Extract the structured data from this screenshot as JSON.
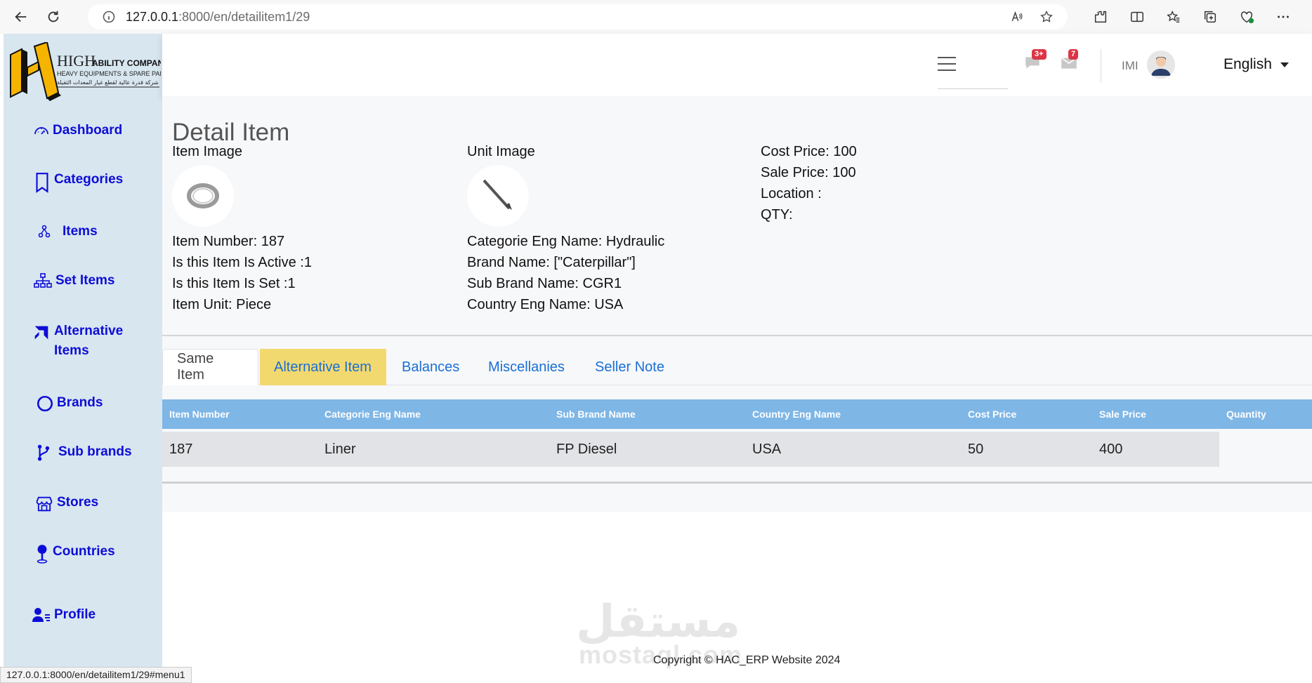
{
  "browser": {
    "url_host": "127.0.0.1",
    "url_path": ":8000/en/detailitem1/29",
    "status_url": "127.0.0.1:8000/en/detailitem1/29#menu1"
  },
  "logo": {
    "brand_high": "HIGH",
    "brand_ability": "ABILITY COMPANY",
    "brand_heavy": "HEAVY EQUIPMENTS & SPARE PARTS",
    "brand_arabic": "شركة قدرة عالية لقطع غيار المعدات الثقيلة"
  },
  "sidebar": {
    "items": [
      {
        "label": "Dashboard"
      },
      {
        "label": "Categories"
      },
      {
        "label": "Items"
      },
      {
        "label": "Set Items"
      },
      {
        "label": "Alternative Items"
      },
      {
        "label": "Brands"
      },
      {
        "label": "Sub brands"
      },
      {
        "label": "Stores"
      },
      {
        "label": "Countries"
      },
      {
        "label": "Profile"
      }
    ]
  },
  "header": {
    "messages_badge": "3+",
    "alerts_badge": "7",
    "user_name": "IMI",
    "language": "English"
  },
  "page": {
    "title": "Detail Item",
    "col1": {
      "image_label": "Item Image",
      "item_number": "Item Number: 187",
      "is_active": "Is this Item Is Active :1",
      "is_set": "Is this Item Is Set :1",
      "unit": "Item Unit: Piece"
    },
    "col2": {
      "image_label": "Unit Image",
      "categorie": "Categorie Eng Name: Hydraulic",
      "brand": "Brand Name: [\"Caterpillar\"]",
      "sub_brand": "Sub Brand Name: CGR1",
      "country": "Country Eng Name: USA"
    },
    "col3": {
      "cost_price": "Cost Price: 100",
      "sale_price": "Sale Price: 100",
      "location": "Location :",
      "qty": "QTY:"
    }
  },
  "tabs": [
    {
      "label": "Same Item"
    },
    {
      "label": "Alternative Item"
    },
    {
      "label": "Balances"
    },
    {
      "label": "Miscellanies"
    },
    {
      "label": "Seller Note"
    }
  ],
  "table": {
    "headers": [
      "Item Number",
      "Categorie Eng Name",
      "Sub Brand Name",
      "Country Eng Name",
      "Cost Price",
      "Sale Price",
      "Quantity"
    ],
    "rows": [
      [
        "187",
        "Liner",
        "FP Diesel",
        "USA",
        "50",
        "400",
        ""
      ]
    ]
  },
  "footer": {
    "copyright": "Copyright © HAC_ERP Website 2024",
    "watermark_arabic": "مستقل",
    "watermark_latin": "mostaql.com"
  },
  "colors": {
    "sidebar_bg": "#d8e6f0",
    "link_blue": "#0d0dd6",
    "table_header": "#7eb6e6",
    "tab_highlight": "#f2d96f",
    "badge_red": "#dc3545"
  }
}
